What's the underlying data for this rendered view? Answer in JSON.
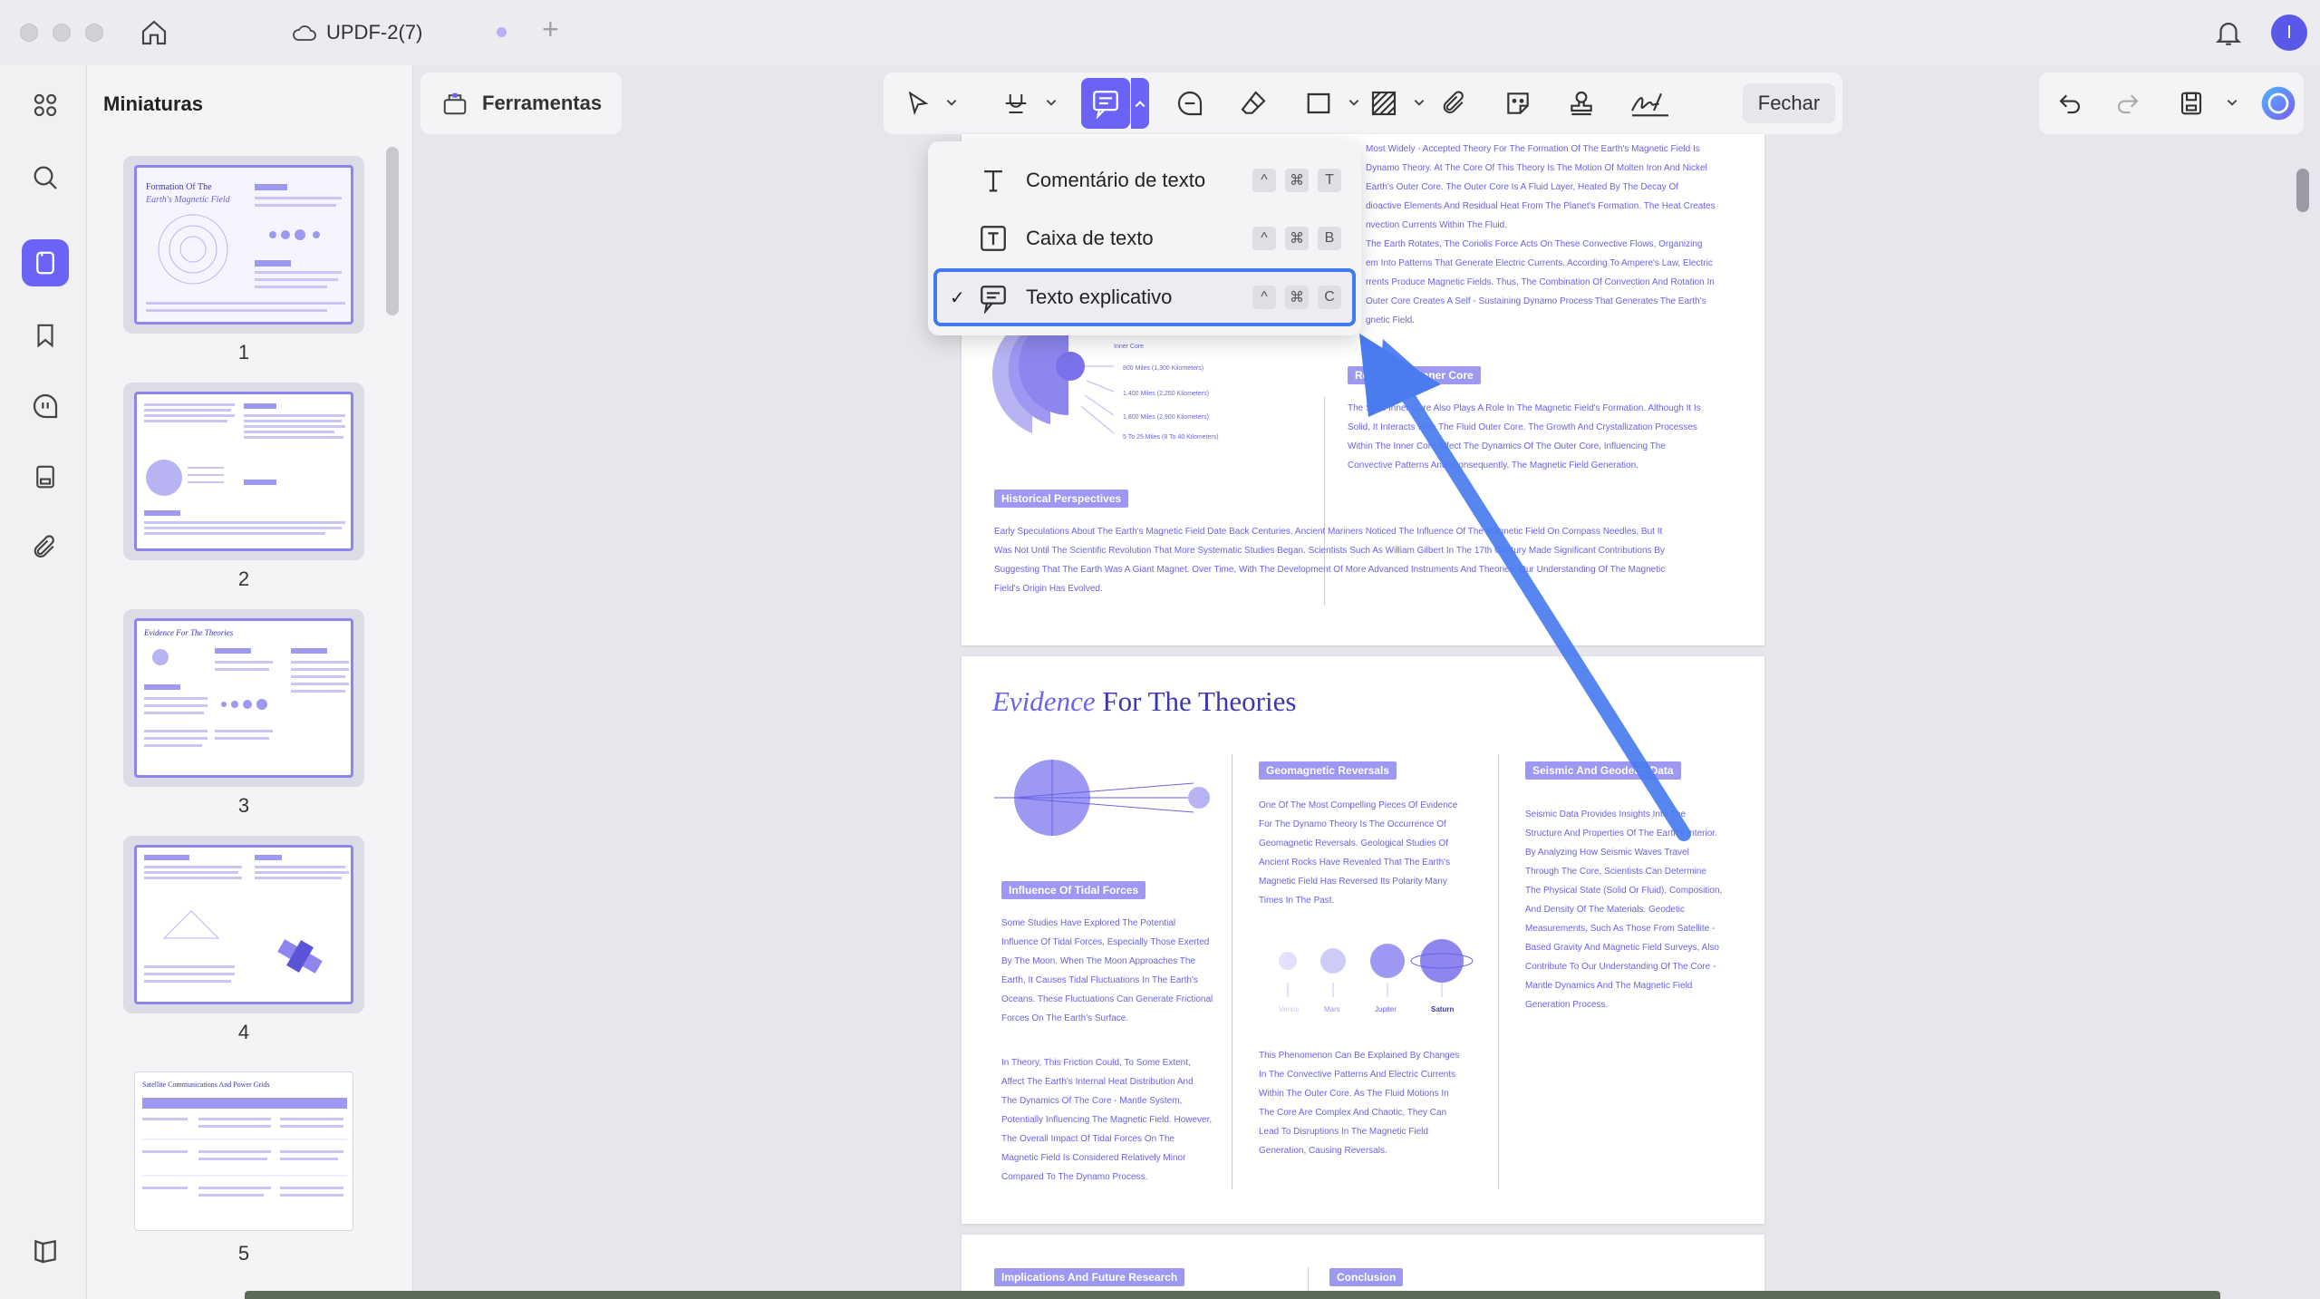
{
  "window": {
    "tab_title": "UPDF-2(7)",
    "user_initial": "I"
  },
  "thumbnails": {
    "title": "Miniaturas",
    "pages": [
      {
        "num": "1",
        "title_a": "Formation Of The",
        "title_b": "Earth's Magnetic Field"
      },
      {
        "num": "2"
      },
      {
        "num": "3",
        "title_a": "Evidence For The Theories"
      },
      {
        "num": "4"
      },
      {
        "num": "5",
        "title_a": "Satellite Communications And Power Grids"
      }
    ]
  },
  "toolbar": {
    "tools_label": "Ferramentas",
    "close_label": "Fechar"
  },
  "dropdown": {
    "items": [
      {
        "label": "Comentário de texto",
        "keys": [
          "^",
          "⌘",
          "T"
        ],
        "selected": false
      },
      {
        "label": "Caixa de texto",
        "keys": [
          "^",
          "⌘",
          "B"
        ],
        "selected": false
      },
      {
        "label": "Texto explicativo",
        "keys": [
          "^",
          "⌘",
          "C"
        ],
        "selected": true,
        "check": "✓"
      }
    ]
  },
  "document": {
    "page2": {
      "right_para_1": [
        "Most Widely - Accepted Theory For The Formation Of The Earth's Magnetic Field Is",
        "Dynamo Theory. At The Core Of This Theory Is The Motion Of Molten Iron And Nickel",
        "Earth's Outer Core. The Outer Core Is A Fluid Layer, Heated By The Decay Of",
        "dioactive Elements And Residual Heat From The Planet's Formation. The Heat Creates",
        "nvection Currents Within The Fluid.",
        "The Earth Rotates, The Coriolis Force Acts On These Convective Flows, Organizing",
        "em Into Patterns That Generate Electric Currents. According To Ampere's Law, Electric",
        "rrents Produce Magnetic Fields. Thus, The Combination Of Convection And Rotation In",
        "Outer Core Creates A Self - Sustaining Dynamo Process That Generates The Earth's",
        "gnetic Field."
      ],
      "inner_core_pill": "Role Of The Inner Core",
      "inner_core_para": [
        "The Solid Inner Core Also Plays A Role In The Magnetic Field's Formation. Although It Is",
        "Solid, It Interacts With The Fluid Outer Core. The Growth And Crystallization Processes",
        "Within The Inner Core Affect The Dynamics Of The Outer Core, Influencing The",
        "Convective Patterns And, Consequently, The Magnetic Field Generation."
      ],
      "diagram_labels": [
        "Inner Core",
        "800 Miles (1,300 Kilometers)",
        "1,400 Miles (2,250 Kilometers)",
        "1,800 Miles (2,900 Kilometers)",
        "5 To 25 Miles (8 To 40 Kilometers)"
      ],
      "historical_pill": "Historical Perspectives",
      "historical_para": [
        "Early Speculations About The Earth's Magnetic Field Date Back Centuries. Ancient Mariners Noticed The Influence Of The Magnetic Field On Compass Needles, But It",
        "Was Not Until The Scientific Revolution That More Systematic Studies Began. Scientists Such As William Gilbert In The 17th Century Made Significant Contributions By",
        "Suggesting That The Earth Was A Giant Magnet. Over Time, With The Development Of More Advanced Instruments And Theories, Our Understanding Of The Magnetic",
        "Field's Origin Has Evolved."
      ]
    },
    "page3": {
      "heading_em": "Evidence",
      "heading_rest": " For The Theories",
      "geomagnetic_pill": "Geomagnetic Reversals",
      "geomagnetic_para": [
        "One Of The Most Compelling Pieces Of Evidence",
        "For The Dynamo Theory Is The Occurrence Of",
        "Geomagnetic Reversals. Geological Studies Of",
        "Ancient Rocks Have Revealed That The Earth's",
        "Magnetic Field Has Reversed Its Polarity Many",
        "Times In The Past."
      ],
      "planet_labels": [
        "Venus",
        "Mars",
        "Jupiter",
        "Saturn"
      ],
      "phenomenon_para": [
        "This Phenomenon Can Be Explained By Changes",
        "In The Convective Patterns And Electric Currents",
        "Within The Outer Core. As The Fluid Motions In",
        "The Core Are Complex And Chaotic, They Can",
        "Lead To Disruptions In The Magnetic Field",
        "Generation, Causing Reversals."
      ],
      "seismic_pill": "Seismic And Geodetic Data",
      "seismic_para": [
        "Seismic Data Provides Insights Into The",
        "Structure And Properties Of The Earth's Interior.",
        "By Analyzing How Seismic Waves Travel",
        "Through The Core, Scientists Can Determine",
        "The Physical State (Solid Or Fluid), Composition,",
        "And Density Of The Materials. Geodetic",
        "Measurements, Such As Those From Satellite -",
        "Based Gravity And Magnetic Field Surveys, Also",
        "Contribute To Our Understanding Of The Core -",
        "Mantle Dynamics And The Magnetic Field",
        "Generation Process."
      ],
      "tidal_pill": "Influence Of Tidal Forces",
      "tidal_para_1": [
        "Some Studies Have Explored The Potential",
        "Influence Of Tidal Forces, Especially Those Exerted",
        "By The Moon. When The Moon Approaches The",
        "Earth, It Causes Tidal Fluctuations In The Earth's",
        "Oceans. These Fluctuations Can Generate Frictional",
        "Forces On The Earth's Surface."
      ],
      "tidal_para_2": [
        "In Theory, This Friction Could, To Some Extent,",
        "Affect The Earth's Internal Heat Distribution And",
        "The Dynamics Of The Core - Mantle System,",
        "Potentially Influencing The Magnetic Field. However,",
        "The Overall Impact Of Tidal Forces On The",
        "Magnetic Field Is Considered Relatively Minor",
        "Compared To The Dynamo Process."
      ]
    },
    "page4": {
      "implications_pill": "Implications And Future Research",
      "conclusion_pill": "Conclusion"
    }
  },
  "colors": {
    "accent": "#6b63f5",
    "doc_text": "#6a62e8",
    "selection_border": "#3f7af0",
    "arrow": "#4a7cf0"
  }
}
